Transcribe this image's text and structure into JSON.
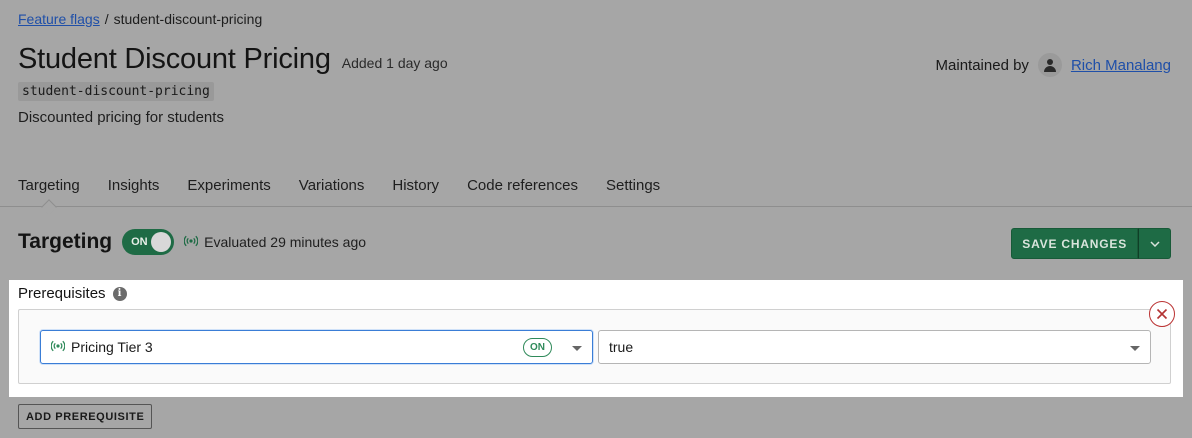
{
  "breadcrumb": {
    "parent": "Feature flags",
    "separator": "/",
    "current": "student-discount-pricing"
  },
  "flag": {
    "name": "Student Discount Pricing",
    "added": "Added 1 day ago",
    "key": "student-discount-pricing",
    "description": "Discounted pricing for students"
  },
  "maintainer": {
    "label": "Maintained by",
    "name": "Rich Manalang"
  },
  "tabs": [
    "Targeting",
    "Insights",
    "Experiments",
    "Variations",
    "History",
    "Code references",
    "Settings"
  ],
  "targeting": {
    "title": "Targeting",
    "toggle_label": "ON",
    "evaluated": "Evaluated 29 minutes ago",
    "save_label": "SAVE CHANGES"
  },
  "prerequisites": {
    "title": "Prerequisites",
    "info_glyph": "i",
    "flag_select": "Pricing Tier 3",
    "flag_status": "ON",
    "value_select": "true",
    "add_label": "ADD PREREQUISITE"
  },
  "colors": {
    "accent_green": "#1e6b45",
    "link_blue": "#1f4fa8",
    "remove_red": "#b33333"
  }
}
